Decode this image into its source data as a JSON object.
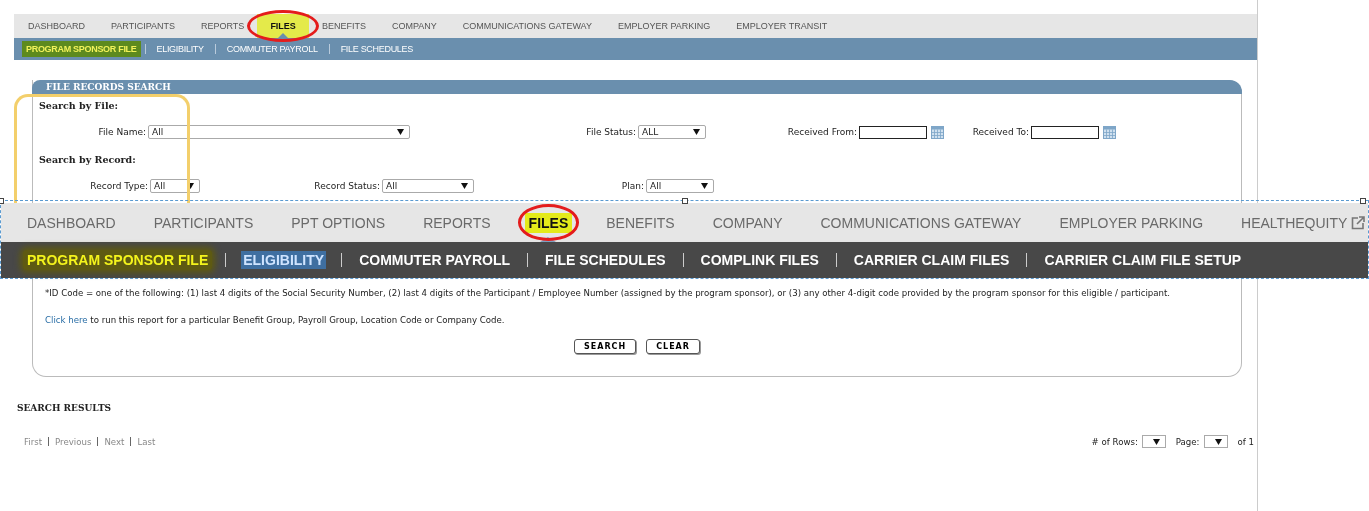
{
  "top_nav": {
    "items": [
      {
        "label": "DASHBOARD",
        "selected": false,
        "circled": false
      },
      {
        "label": "PARTICIPANTS",
        "selected": false,
        "circled": false
      },
      {
        "label": "REPORTS",
        "selected": false,
        "circled": false
      },
      {
        "label": "FILES",
        "selected": true,
        "circled": true
      },
      {
        "label": "BENEFITS",
        "selected": false,
        "circled": false
      },
      {
        "label": "COMPANY",
        "selected": false,
        "circled": false
      },
      {
        "label": "COMMUNICATIONS GATEWAY",
        "selected": false,
        "circled": false
      },
      {
        "label": "EMPLOYER PARKING",
        "selected": false,
        "circled": false
      },
      {
        "label": "EMPLOYER TRANSIT",
        "selected": false,
        "circled": false
      }
    ]
  },
  "sub_nav": {
    "items": [
      {
        "label": "PROGRAM SPONSOR FILE",
        "selected": true
      },
      {
        "label": "ELIGIBILITY",
        "selected": false
      },
      {
        "label": "COMMUTER PAYROLL",
        "selected": false
      },
      {
        "label": "FILE SCHEDULES",
        "selected": false
      }
    ]
  },
  "panel": {
    "title": "FILE RECORDS SEARCH",
    "sections": [
      {
        "heading": "Search by File:",
        "fields": [
          {
            "kind": "select",
            "label": "File Name:",
            "value": "All"
          },
          {
            "kind": "select",
            "label": "File Status:",
            "value": "ALL"
          },
          {
            "kind": "date",
            "label": "Received From:"
          },
          {
            "kind": "date",
            "label": "Received To:"
          }
        ]
      },
      {
        "heading": "Search by Record:",
        "fields": [
          {
            "kind": "select",
            "label": "Record Type:",
            "value": "All"
          },
          {
            "kind": "select",
            "label": "Record Status:",
            "value": "All"
          },
          {
            "kind": "select",
            "label": "Plan:",
            "value": "All"
          }
        ]
      }
    ],
    "note": "*ID Code = one of the following: (1) last 4 digits of the Social Security Number, (2) last 4 digits of the Participant / Employee Number (assigned by the program sponsor), or (3) any other 4-digit code provided by the program sponsor for this eligible / participant.",
    "link_text": "Click here",
    "link_rest": " to run this report for a particular Benefit Group, Payroll Group, Location Code or Company Code.",
    "buttons": [
      "SEARCH",
      "CLEAR"
    ]
  },
  "results": {
    "title": "SEARCH RESULTS",
    "pager": [
      "First",
      "Previous",
      "Next",
      "Last"
    ],
    "rows_label": "# of Rows:",
    "page_label": "Page:",
    "page_total": "of 1"
  },
  "overlay_nav": {
    "items": [
      {
        "label": "DASHBOARD",
        "selected": false,
        "circled": false,
        "external": false
      },
      {
        "label": "PARTICIPANTS",
        "selected": false,
        "circled": false,
        "external": false
      },
      {
        "label": "PPT OPTIONS",
        "selected": false,
        "circled": false,
        "external": false
      },
      {
        "label": "REPORTS",
        "selected": false,
        "circled": false,
        "external": false
      },
      {
        "label": "FILES",
        "selected": true,
        "circled": true,
        "external": false
      },
      {
        "label": "BENEFITS",
        "selected": false,
        "circled": false,
        "external": false
      },
      {
        "label": "COMPANY",
        "selected": false,
        "circled": false,
        "external": false
      },
      {
        "label": "COMMUNICATIONS GATEWAY",
        "selected": false,
        "circled": false,
        "external": false
      },
      {
        "label": "EMPLOYER PARKING",
        "selected": false,
        "circled": false,
        "external": false
      },
      {
        "label": "HEALTHEQUITY",
        "selected": false,
        "circled": false,
        "external": true
      }
    ],
    "sub_items": [
      {
        "label": "PROGRAM SPONSOR FILE",
        "selected": true,
        "highlighted": false
      },
      {
        "label": "ELIGIBILITY",
        "selected": false,
        "highlighted": true
      },
      {
        "label": "COMMUTER PAYROLL",
        "selected": false,
        "highlighted": false
      },
      {
        "label": "FILE SCHEDULES",
        "selected": false,
        "highlighted": false
      },
      {
        "label": "COMPLINK FILES",
        "selected": false,
        "highlighted": false
      },
      {
        "label": "CARRIER CLAIM FILES",
        "selected": false,
        "highlighted": false
      },
      {
        "label": "CARRIER CLAIM FILE SETUP",
        "selected": false,
        "highlighted": false
      }
    ]
  }
}
